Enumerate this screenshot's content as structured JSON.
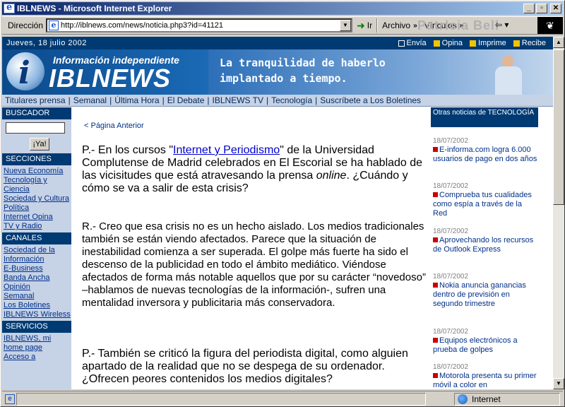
{
  "window": {
    "title": "IBLNEWS - Microsoft Internet Explorer",
    "buttons": [
      "_",
      "▫",
      "✕"
    ]
  },
  "toolbar": {
    "address_label": "Dirección",
    "url": "http://iblnews.com/news/noticia.php3?id=41121",
    "go_label": "Ir",
    "archivo_label": "Archivo",
    "vinculos_label": "Vínculos",
    "brandmark": "Patricia Bell"
  },
  "status": {
    "zone": "Internet"
  },
  "page": {
    "date": "Jueves, 18 julio 2002",
    "actions": [
      "Envía",
      "Opina",
      "Imprime",
      "Recibe"
    ],
    "banner": {
      "subtitle": "Información independiente",
      "brand": "IBLNEWS",
      "ad_line1": "La tranquilidad de haberlo",
      "ad_line2": "implantado a tiempo."
    },
    "nav": [
      "Titulares prensa",
      "Semanal",
      "Última Hora",
      "El Debate",
      "IBLNEWS TV",
      "Tecnología",
      "Suscríbete a Los Boletines"
    ],
    "left": {
      "buscador": "BUSCADOR",
      "ya_button": "¡Ya!",
      "secciones": "SECCIONES",
      "secciones_items": [
        "Nueva Economía",
        "Tecnología y Ciencia",
        "Sociedad y Cultura",
        "Política",
        "Internet Opina",
        "TV y Radio"
      ],
      "canales": "CANALES",
      "canales_items": [
        "Sociedad de la Información",
        "E-Business",
        "Banda Ancha",
        "Opinión",
        "Semanal",
        "Los Boletines",
        "IBLNEWS Wireless"
      ],
      "servicios": "SERVICIOS",
      "servicios_items": [
        "IBLNEWS, mi home page",
        "Acceso a"
      ]
    },
    "article": {
      "back": "< Página Anterior",
      "q1_pre": "P.- En los cursos \"",
      "q1_link": "Internet y Periodismo",
      "q1_post": "\" de la Universidad Complutense de Madrid celebrados en El Escorial se ha hablado de las vicisitudes que está atravesando la prensa ",
      "q1_em": "online",
      "q1_end": ". ¿Cuándo y cómo se va a salir de esta crisis?",
      "r1": "R.- Creo que esa crisis no es un hecho aislado. Los medios tradicionales también se están viendo afectados. Parece que la situación de inestabilidad comienza a ser superada. El golpe más fuerte ha sido el descenso de la publicidad en todo el ámbito mediático. Viéndose afectados de forma más notable aquellos que por su carácter “novedoso” –hablamos de nuevas tecnologías de la información-, sufren una mentalidad inversora y publicitaria más conservadora.",
      "q2": "P.- También se criticó la figura del periodista digital, como alguien apartado de la realidad que no se despega de su ordenador. ¿Ofrecen peores contenidos los medios digitales?"
    },
    "right": {
      "header": "Otras noticias de TECNOLOGÍA",
      "items": [
        {
          "date": "18/07/2002",
          "text": "E-informa.com logra 6.000 usuarios de pago en dos años"
        },
        {
          "date": "18/07/2002",
          "text": "Comprueba tus cualidades como espía a través de la Red"
        },
        {
          "date": "18/07/2002",
          "text": "Aprovechando los recursos de Outlook Express"
        },
        {
          "date": "18/07/2002",
          "text": "Nokia anuncia ganancias dentro de previsión en segundo trimestre"
        },
        {
          "date": "18/07/2002",
          "text": "Equipos electrónicos a prueba de golpes"
        },
        {
          "date": "18/07/2002",
          "text": "Motorola presenta su primer móvil a color en"
        }
      ]
    }
  }
}
